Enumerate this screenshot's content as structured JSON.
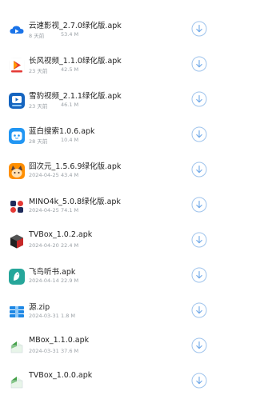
{
  "files": [
    {
      "name": "云速影视_2.7.0绿化版.apk",
      "date": "8 天前",
      "size": "53.4 M",
      "icon": "cloud-video-icon",
      "accent": "#1a73e8"
    },
    {
      "name": "长风视频_1.1.0绿化版.apk",
      "date": "23 天前",
      "size": "42.5 M",
      "icon": "changfeng-video-icon",
      "accent": "#e53935"
    },
    {
      "name": "雪豹视频_2.1.1绿化版.apk",
      "date": "23 天前",
      "size": "46.1 M",
      "icon": "snow-leopard-video-icon",
      "accent": "#1565c0"
    },
    {
      "name": "蓝白搜索1.0.6.apk",
      "date": "28 天前",
      "size": "10.4 M",
      "icon": "blue-white-search-icon",
      "accent": "#2196f3"
    },
    {
      "name": "囧次元_1.5.6.9绿化版.apk",
      "date": "2024-04-25",
      "size": "43.4 M",
      "icon": "jiong-anime-icon",
      "accent": "#ff8f00"
    },
    {
      "name": "MINO4k_5.0.8绿化版.apk",
      "date": "2024-04-25",
      "size": "74.1 M",
      "icon": "mino4k-icon",
      "accent": "#1e2a5a"
    },
    {
      "name": "TVBox_1.0.2.apk",
      "date": "2024-04-20",
      "size": "22.4 M",
      "icon": "tvbox-cube-icon",
      "accent": "#c62828"
    },
    {
      "name": "飞鸟听书.apk",
      "date": "2024-04-14",
      "size": "22.9 M",
      "icon": "bird-audiobook-icon",
      "accent": "#26a69a"
    },
    {
      "name": "源.zip",
      "date": "2024-03-31",
      "size": "1.8 M",
      "icon": "zip-archive-icon",
      "accent": "#1e88e5"
    },
    {
      "name": "MBox_1.1.0.apk",
      "date": "2024-03-31",
      "size": "37.6 M",
      "icon": "apk-file-icon",
      "accent": "#43a047"
    },
    {
      "name": "TVBox_1.0.0.apk",
      "date": "",
      "size": "",
      "icon": "apk-file-icon",
      "accent": "#43a047"
    }
  ]
}
